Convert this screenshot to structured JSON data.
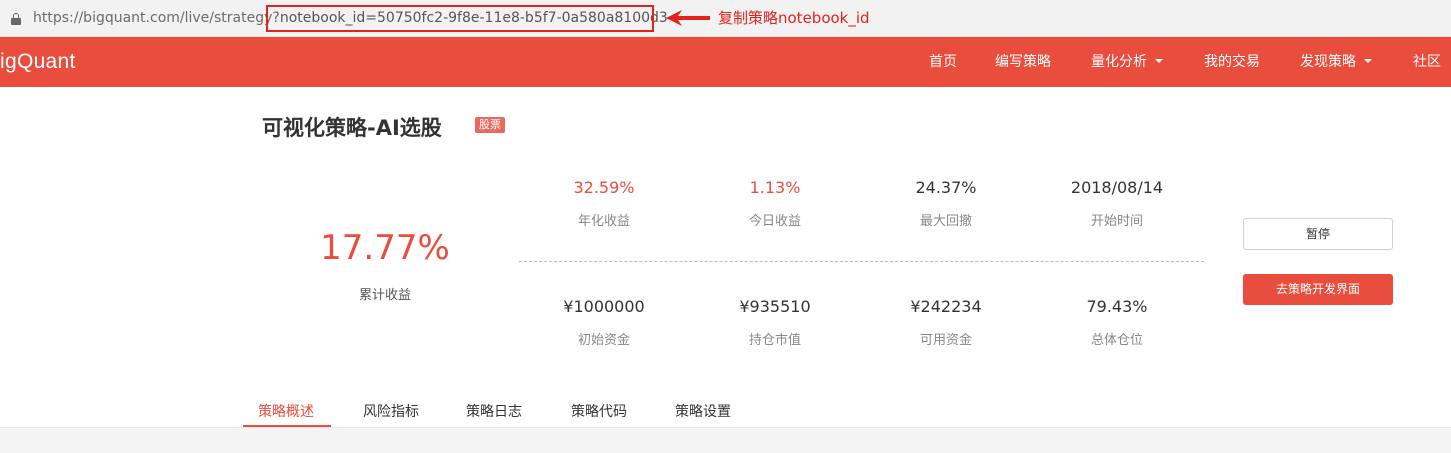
{
  "browser": {
    "url_prefix": "https://bigquant.com/live/strategy",
    "url_separator": "?",
    "url_highlight": "notebook_id=50750fc2-9f8e-11e8-b5f7-0a580a8100d3",
    "annotation": "复制策略notebook_id",
    "annotation_color": "#e3221b"
  },
  "nav": {
    "logo": "igQuant",
    "items": [
      {
        "label": "首页",
        "dropdown": false
      },
      {
        "label": "编写策略",
        "dropdown": false
      },
      {
        "label": "量化分析",
        "dropdown": true
      },
      {
        "label": "我的交易",
        "dropdown": false
      },
      {
        "label": "发现策略",
        "dropdown": true
      },
      {
        "label": "社区",
        "dropdown": false
      }
    ],
    "bg_color": "#e84d3d"
  },
  "strategy": {
    "title": "可视化策略-AI选股",
    "tag": "股票",
    "cumulative_return": {
      "value": "17.77%",
      "label": "累计收益"
    },
    "metrics_top": [
      {
        "value": "32.59%",
        "label": "年化收益",
        "highlight": true
      },
      {
        "value": "1.13%",
        "label": "今日收益",
        "highlight": true
      },
      {
        "value": "24.37%",
        "label": "最大回撤",
        "highlight": false
      },
      {
        "value": "2018/08/14",
        "label": "开始时间",
        "highlight": false
      }
    ],
    "metrics_bottom": [
      {
        "value": "¥1000000",
        "label": "初始资金"
      },
      {
        "value": "¥935510",
        "label": "持仓市值"
      },
      {
        "value": "¥242234",
        "label": "可用资金"
      },
      {
        "value": "79.43%",
        "label": "总体仓位"
      }
    ]
  },
  "actions": {
    "pause_label": "暂停",
    "dev_label": "去策略开发界面"
  },
  "tabs": [
    {
      "label": "策略概述",
      "active": true
    },
    {
      "label": "风险指标",
      "active": false
    },
    {
      "label": "策略日志",
      "active": false
    },
    {
      "label": "策略代码",
      "active": false
    },
    {
      "label": "策略设置",
      "active": false
    }
  ],
  "colors": {
    "accent": "#e84d3d",
    "tag_bg": "#e96b5f"
  }
}
